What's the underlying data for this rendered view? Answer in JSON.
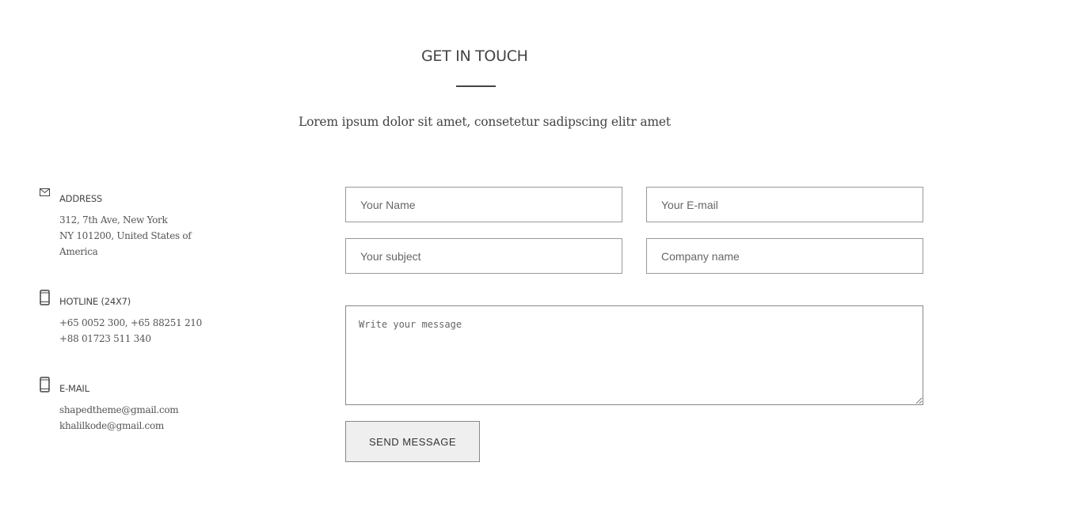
{
  "header": {
    "title": "GET IN TOUCH",
    "subtitle": "Lorem ipsum dolor sit amet, consetetur sadipscing elitr amet"
  },
  "contact": {
    "address": {
      "icon": "envelope-icon",
      "heading": "ADDRESS",
      "lines": [
        "312, 7th Ave, New York",
        "NY 101200, United States of",
        "America"
      ]
    },
    "hotline": {
      "icon": "mobile-phone-icon",
      "heading": "HOTLINE (24X7)",
      "lines": [
        "+65 0052 300, +65 88251 210",
        "+88 01723 511 340"
      ]
    },
    "email": {
      "icon": "mobile-phone-icon",
      "heading": "E-MAIL",
      "lines": [
        "shapedtheme@gmail.com",
        "khalilkode@gmail.com"
      ]
    }
  },
  "form": {
    "name_placeholder": "Your Name",
    "email_placeholder": "Your E-mail",
    "subject_placeholder": "Your subject",
    "company_placeholder": "Company name",
    "message_placeholder": "Write your message",
    "submit_label": "SEND MESSAGE"
  }
}
